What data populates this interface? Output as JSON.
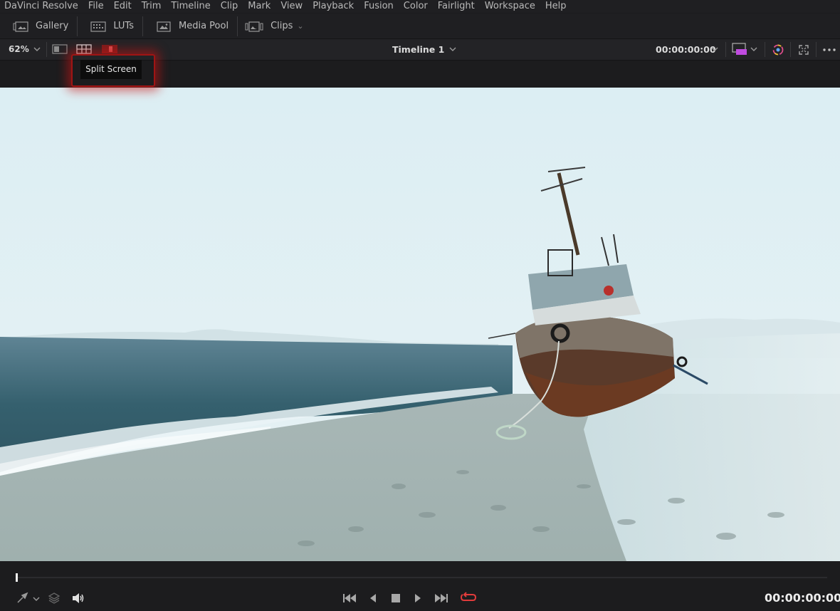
{
  "app": {
    "menu": [
      "DaVinci Resolve",
      "File",
      "Edit",
      "Trim",
      "Timeline",
      "Clip",
      "Mark",
      "View",
      "Playback",
      "Fusion",
      "Color",
      "Fairlight",
      "Workspace",
      "Help"
    ]
  },
  "toolbar": {
    "gallery_label": "Gallery",
    "luts_label": "LUTs",
    "media_pool_label": "Media Pool",
    "clips_label": "Clips"
  },
  "viewer": {
    "zoom": "62%",
    "timeline_name": "Timeline 1",
    "timecode": "00:00:00:00",
    "tooltip": "Split Screen",
    "icons": [
      "single-viewer-icon",
      "split-screen-icon",
      "highlight-mode-icon",
      "proxy-icon",
      "color-wheel-icon",
      "fullscreen-icon",
      "more-options-icon"
    ]
  },
  "transport": {
    "timecode": "00:00:00:00",
    "icons": [
      "pen-tool-icon",
      "layers-icon",
      "volume-icon",
      "skip-to-start-icon",
      "play-reverse-icon",
      "stop-icon",
      "play-icon",
      "skip-to-end-icon",
      "loop-icon"
    ],
    "loop_color": "#e03b3b"
  },
  "colors": {
    "highlight": "#b01818",
    "proxy_badge": "#c04be0"
  }
}
